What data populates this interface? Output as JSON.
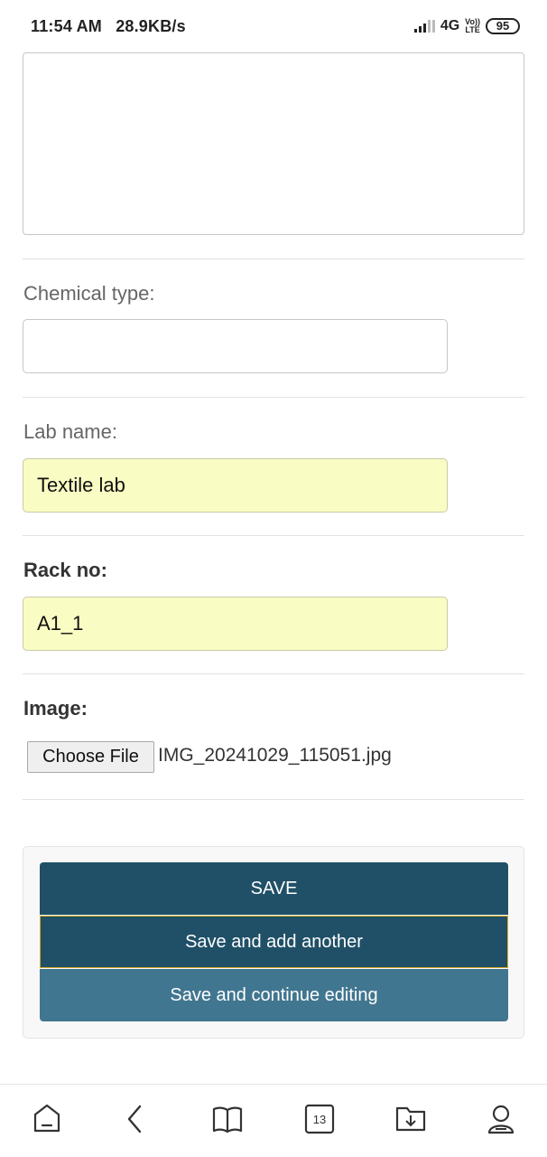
{
  "status_bar": {
    "time": "11:54 AM",
    "speed": "28.9KB/s",
    "network": "4G",
    "volte_top": "Vo))",
    "volte_bottom": "LTE",
    "battery": "95"
  },
  "form": {
    "chemical_type": {
      "label": "Chemical type:",
      "value": ""
    },
    "lab_name": {
      "label": "Lab name:",
      "value": "Textile lab"
    },
    "rack_no": {
      "label": "Rack no:",
      "value": "A1_1"
    },
    "image": {
      "label": "Image:",
      "button_label": "Choose File",
      "file_name": "IMG_20241029_115051.jpg"
    }
  },
  "submit": {
    "save_label": "SAVE",
    "save_add_label": "Save and add another",
    "save_continue_label": "Save and continue editing"
  },
  "bottom_nav": {
    "tabs_count": "13",
    "icons": [
      "home-icon",
      "back-icon",
      "bookmarks-icon",
      "tabs-icon",
      "downloads-icon",
      "profile-icon"
    ]
  },
  "colors": {
    "primary_button": "#205067",
    "secondary_button": "#417690",
    "autofill_background": "#fafdc3",
    "focus_border": "#d4a91e"
  }
}
